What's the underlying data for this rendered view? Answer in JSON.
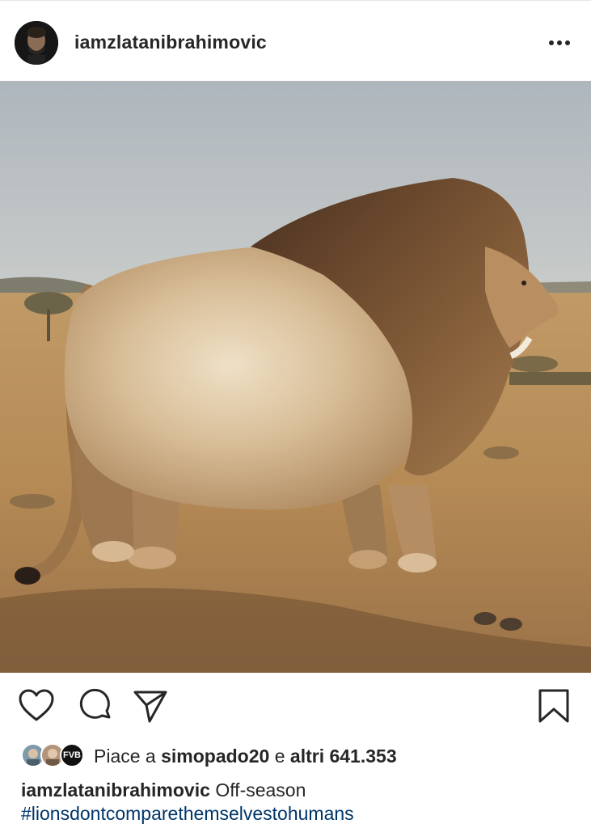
{
  "post": {
    "username": "iamzlatanibrahimovic",
    "more_icon": "more-horizontal-icon"
  },
  "image": {
    "description_icon": "lion-photo"
  },
  "actions": {
    "like_icon": "heart-icon",
    "comment_icon": "comment-icon",
    "share_icon": "send-icon",
    "save_icon": "bookmark-icon"
  },
  "likes": {
    "prefix": "Piace a",
    "user": "simopado20",
    "middle": "e",
    "others": "altri 641.353",
    "avatar3_text": "FVB"
  },
  "caption": {
    "username": "iamzlatanibrahimovic",
    "text": "Off-season",
    "hashtag": "#lionsdontcomparethemselvestohumans"
  }
}
